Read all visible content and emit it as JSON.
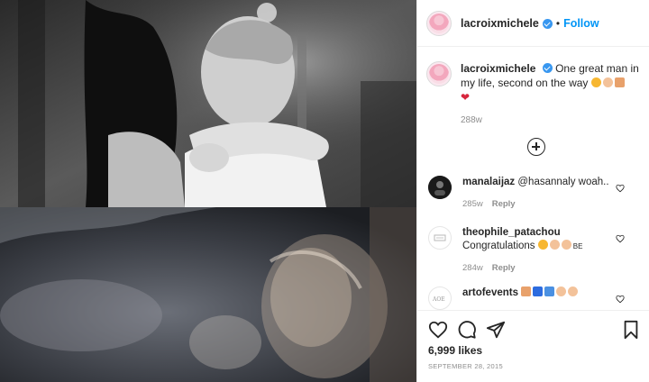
{
  "header": {
    "username": "lacroixmichele",
    "follow_label": "Follow",
    "separator": "•"
  },
  "caption": {
    "username": "lacroixmichele",
    "text": "One great man in my life, second on the way",
    "time": "288w"
  },
  "comments": [
    {
      "username": "manalaijaz",
      "text": "@hasannaly woah..",
      "time": "285w",
      "reply_label": "Reply"
    },
    {
      "username": "theophile_patachou",
      "text": "Congratulations",
      "suffix": "BE",
      "time": "284w",
      "reply_label": "Reply"
    },
    {
      "username": "artofevents",
      "text": ""
    }
  ],
  "engagement": {
    "likes": "6,999 likes",
    "date": "SEPTEMBER 28, 2015"
  },
  "icons": {
    "verified": "verified-badge-icon",
    "load_more": "plus-circle-icon",
    "like": "heart-icon",
    "comment": "comment-bubble-icon",
    "share": "paper-plane-icon",
    "save": "bookmark-icon"
  },
  "colors": {
    "link": "#0095f6",
    "verified": "#3897f0",
    "muted": "#8e8e8e",
    "text": "#262626",
    "heart_emoji": "#d7263d"
  }
}
